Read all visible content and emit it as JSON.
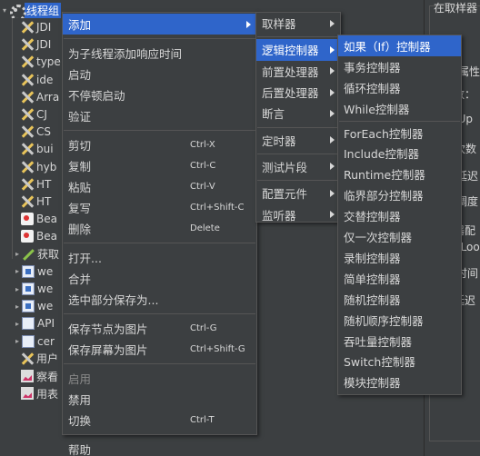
{
  "tree": {
    "root_label": "线程组",
    "items": [
      {
        "label": "JDI",
        "icon": "sampler-icon"
      },
      {
        "label": "JDI",
        "icon": "sampler-icon"
      },
      {
        "label": "type",
        "icon": "sampler-icon"
      },
      {
        "label": "ide",
        "icon": "sampler-icon"
      },
      {
        "label": "Arra",
        "icon": "sampler-icon"
      },
      {
        "label": "CJ",
        "icon": "sampler-icon"
      },
      {
        "label": "CS",
        "icon": "sampler-icon"
      },
      {
        "label": "bui",
        "icon": "sampler-icon"
      },
      {
        "label": "hyb",
        "icon": "sampler-icon"
      },
      {
        "label": "HT",
        "icon": "sampler-icon"
      },
      {
        "label": "HT",
        "icon": "sampler-icon"
      },
      {
        "label": "Bea",
        "icon": "bean-icon"
      },
      {
        "label": "Bea",
        "icon": "bean-icon"
      },
      {
        "label": "获取",
        "icon": "getter-icon"
      },
      {
        "label": "we",
        "icon": "web-icon"
      },
      {
        "label": "we",
        "icon": "web-icon"
      },
      {
        "label": "we",
        "icon": "web-icon"
      },
      {
        "label": "API",
        "icon": "api-icon"
      },
      {
        "label": "cer",
        "icon": "api-icon"
      },
      {
        "label": "用户",
        "icon": "sampler-icon"
      },
      {
        "label": "察看",
        "icon": "listener-icon"
      },
      {
        "label": "用表",
        "icon": "listener-icon"
      }
    ]
  },
  "right_panel": {
    "title": "在取样器",
    "lines": [
      "程属性",
      "程数：",
      "mp-Up",
      "环次数",
      "延迟",
      "调度",
      "度器配",
      "If Loo",
      "续时间",
      "动延迟"
    ]
  },
  "context_menu": {
    "items": [
      {
        "label": "添加",
        "submenu": true,
        "highlighted": true
      },
      {
        "sep": true
      },
      {
        "label": "为子线程添加响应时间"
      },
      {
        "label": "启动"
      },
      {
        "label": "不停顿启动"
      },
      {
        "label": "验证"
      },
      {
        "sep": true
      },
      {
        "label": "剪切",
        "shortcut": "Ctrl-X"
      },
      {
        "label": "复制",
        "shortcut": "Ctrl-C"
      },
      {
        "label": "粘贴",
        "shortcut": "Ctrl-V"
      },
      {
        "label": "复写",
        "shortcut": "Ctrl+Shift-C"
      },
      {
        "label": "删除",
        "shortcut": "Delete"
      },
      {
        "sep": true
      },
      {
        "label": "打开..."
      },
      {
        "label": "合并"
      },
      {
        "label": "选中部分保存为..."
      },
      {
        "sep": true
      },
      {
        "label": "保存节点为图片",
        "shortcut": "Ctrl-G"
      },
      {
        "label": "保存屏幕为图片",
        "shortcut": "Ctrl+Shift-G"
      },
      {
        "sep": true
      },
      {
        "label": "启用",
        "disabled": true
      },
      {
        "label": "禁用"
      },
      {
        "label": "切换",
        "shortcut": "Ctrl-T"
      },
      {
        "sep": true
      },
      {
        "label": "帮助"
      }
    ]
  },
  "add_submenu": {
    "items": [
      {
        "label": "取样器",
        "submenu": true
      },
      {
        "sep": true
      },
      {
        "label": "逻辑控制器",
        "submenu": true,
        "highlighted": true
      },
      {
        "label": "前置处理器",
        "submenu": true
      },
      {
        "label": "后置处理器",
        "submenu": true
      },
      {
        "label": "断言",
        "submenu": true
      },
      {
        "sep": true
      },
      {
        "label": "定时器",
        "submenu": true
      },
      {
        "sep": true
      },
      {
        "label": "测试片段",
        "submenu": true
      },
      {
        "sep": true
      },
      {
        "label": "配置元件",
        "submenu": true
      },
      {
        "label": "监听器",
        "submenu": true
      }
    ]
  },
  "logic_submenu": {
    "items": [
      {
        "label": "如果（If）控制器",
        "highlighted": true
      },
      {
        "label": "事务控制器"
      },
      {
        "label": "循环控制器"
      },
      {
        "label": "While控制器"
      },
      {
        "sep": true
      },
      {
        "label": "ForEach控制器"
      },
      {
        "label": "Include控制器"
      },
      {
        "label": "Runtime控制器"
      },
      {
        "label": "临界部分控制器"
      },
      {
        "label": "交替控制器"
      },
      {
        "label": "仅一次控制器"
      },
      {
        "label": "录制控制器"
      },
      {
        "label": "简单控制器"
      },
      {
        "label": "随机控制器"
      },
      {
        "label": "随机顺序控制器"
      },
      {
        "label": "吞吐量控制器"
      },
      {
        "label": "Switch控制器"
      },
      {
        "label": "模块控制器"
      }
    ]
  },
  "colors": {
    "background": "#3c3f41",
    "highlight": "#2f65ca",
    "text": "#d7d7d7",
    "disabled_text": "#8a8a8a"
  }
}
